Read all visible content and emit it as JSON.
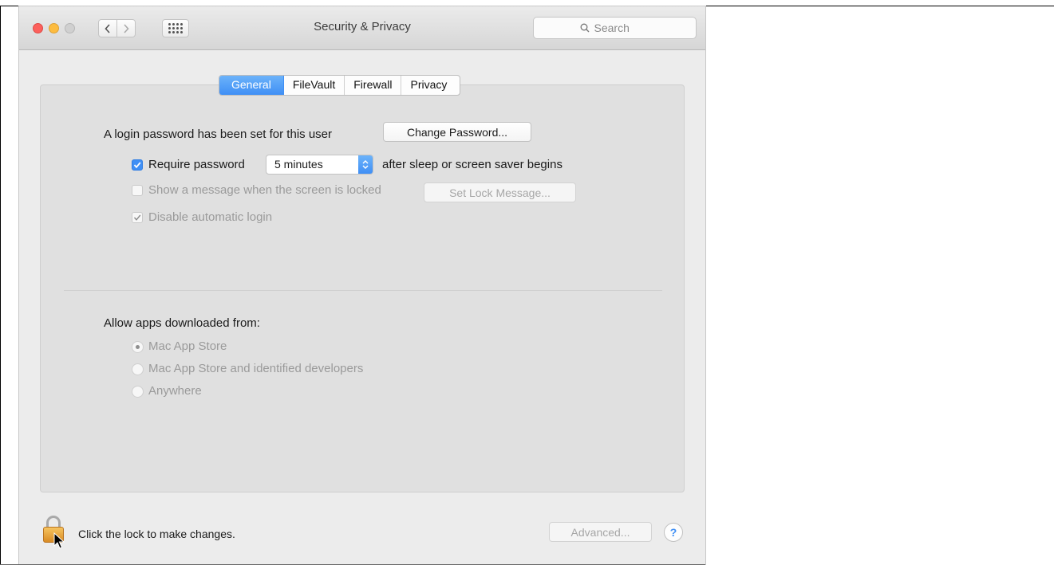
{
  "window": {
    "title": "Security & Privacy",
    "search_placeholder": "Search"
  },
  "tabs": [
    {
      "label": "General",
      "active": true
    },
    {
      "label": "FileVault",
      "active": false
    },
    {
      "label": "Firewall",
      "active": false
    },
    {
      "label": "Privacy",
      "active": false
    }
  ],
  "general": {
    "login_text": "A login password has been set for this user",
    "change_password_label": "Change Password...",
    "require_password": {
      "checked": true,
      "label": "Require password",
      "delay_value": "5 minutes",
      "suffix": "after sleep or screen saver begins"
    },
    "show_message": {
      "checked": false,
      "enabled": false,
      "label": "Show a message when the screen is locked",
      "button_label": "Set Lock Message..."
    },
    "disable_auto_login": {
      "checked": true,
      "enabled": false,
      "label": "Disable automatic login"
    }
  },
  "gatekeeper": {
    "heading": "Allow apps downloaded from:",
    "options": [
      {
        "label": "Mac App Store",
        "selected": true
      },
      {
        "label": "Mac App Store and identified developers",
        "selected": false
      },
      {
        "label": "Anywhere",
        "selected": false
      }
    ]
  },
  "footer": {
    "lock_text": "Click the lock to make changes.",
    "advanced_label": "Advanced...",
    "help_label": "?"
  },
  "colors": {
    "accent_blue": "#3f8ff5",
    "window_bg": "#ececec",
    "panel_bg": "#e0e0e0",
    "disabled_text": "#9a9a9a"
  }
}
